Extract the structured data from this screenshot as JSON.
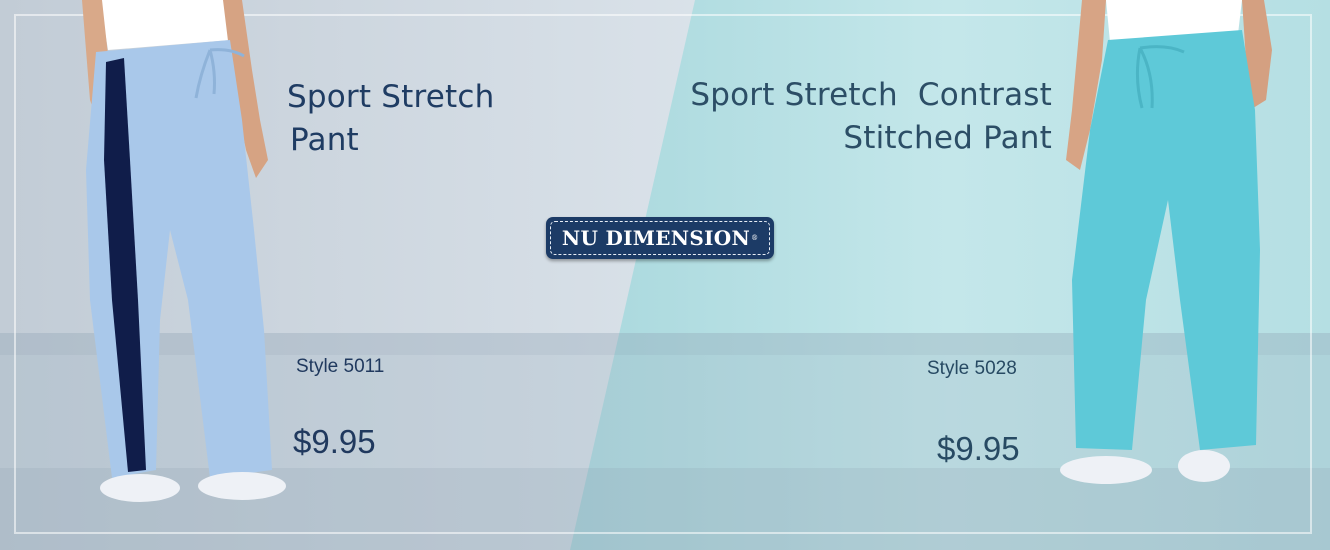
{
  "brand": {
    "logo_text": "NU DIMENSION",
    "logo_mark": "®",
    "logo_color": "#1c3b66"
  },
  "products": [
    {
      "title_lines": [
        "Sport Stretch",
        "Pant"
      ],
      "style": "Style 5011",
      "price": "$9.95",
      "pant_color": "#a9c8ea",
      "stripe_color": "#101d4a"
    },
    {
      "title_lines": [
        "Sport Stretch  Contrast",
        "Stitched Pant"
      ],
      "style": "Style 5028",
      "price": "$9.95",
      "pant_color": "#5ec9d8"
    }
  ],
  "colors": {
    "left_panel": "#c9d4de",
    "right_panel": "#bfe3e6",
    "text": "#1f3c63"
  }
}
